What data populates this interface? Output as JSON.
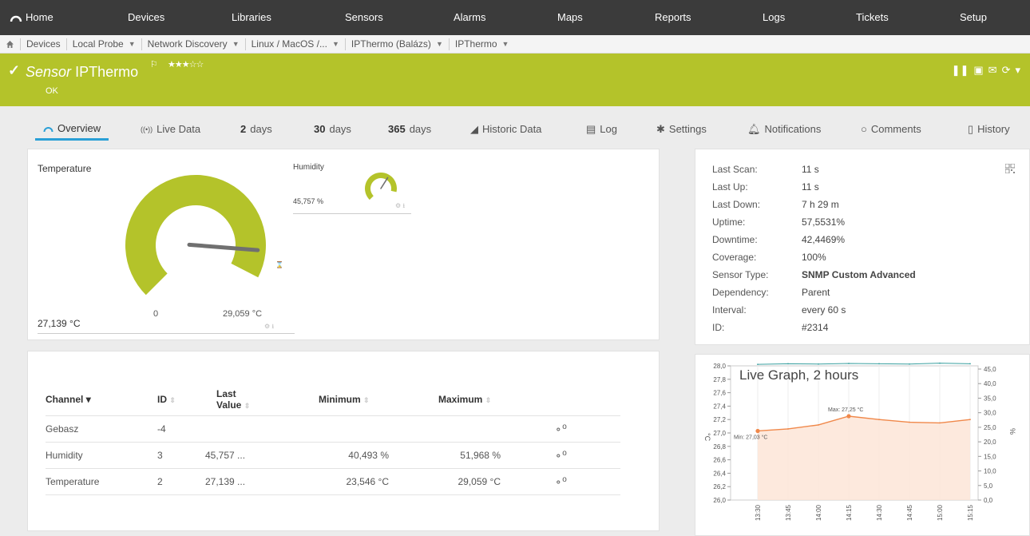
{
  "nav": {
    "home": "Home",
    "items": [
      "Devices",
      "Libraries",
      "Sensors",
      "Alarms",
      "Maps",
      "Reports",
      "Logs",
      "Tickets",
      "Setup"
    ]
  },
  "breadcrumb": [
    "Devices",
    "Local Probe",
    "Network Discovery",
    "Linux / MacOS /...",
    "IPThermo (Balázs)",
    "IPThermo"
  ],
  "header": {
    "prefix": "Sensor",
    "name": "IPThermo",
    "status": "OK",
    "stars": "★★★☆☆",
    "accent": "#b4c32a"
  },
  "tabs": {
    "overview": "Overview",
    "live": "Live Data",
    "d2_num": "2",
    "d2_unit": "days",
    "d30_num": "30",
    "d30_unit": "days",
    "d365_num": "365",
    "d365_unit": "days",
    "historic": "Historic Data",
    "log": "Log",
    "settings": "Settings",
    "notifications": "Notifications",
    "comments": "Comments",
    "history": "History"
  },
  "gauges": {
    "temperature": {
      "title": "Temperature",
      "value": "27,139 °C",
      "min": "0",
      "max": "29,059 °C",
      "level": 0.934
    },
    "humidity": {
      "title": "Humidity",
      "value": "45,757 %",
      "level": 0.88
    }
  },
  "table": {
    "headers": {
      "channel": "Channel",
      "id": "ID",
      "last_value_1": "Last",
      "last_value_2": "Value",
      "minimum": "Minimum",
      "maximum": "Maximum"
    },
    "rows": [
      {
        "channel": "Gebasz",
        "id": "-4",
        "last": "",
        "min": "",
        "max": ""
      },
      {
        "channel": "Humidity",
        "id": "3",
        "last": "45,757 ...",
        "min": "40,493 %",
        "max": "51,968 %"
      },
      {
        "channel": "Temperature",
        "id": "2",
        "last": "27,139 ...",
        "min": "23,546 °C",
        "max": "29,059 °C"
      }
    ]
  },
  "info": [
    {
      "k": "Last Scan:",
      "v": "11 s"
    },
    {
      "k": "Last Up:",
      "v": "11 s"
    },
    {
      "k": "Last Down:",
      "v": "7 h 29 m"
    },
    {
      "k": "Uptime:",
      "v": "57,5531%"
    },
    {
      "k": "Downtime:",
      "v": "42,4469%"
    },
    {
      "k": "Coverage:",
      "v": "100%"
    },
    {
      "k": "Sensor Type:",
      "v": "SNMP Custom Advanced"
    },
    {
      "k": "Dependency:",
      "v": "Parent"
    },
    {
      "k": "Interval:",
      "v": "every  60 s"
    },
    {
      "k": "ID:",
      "v": "#2314"
    }
  ],
  "graph": {
    "title": "Live Graph, 2 hours",
    "max_label": "Max: 27,25 °C",
    "min_label": "Min: 27,03 °C",
    "left_unit": "°C",
    "right_unit": "%",
    "left_ticks": [
      "28,0",
      "27,8",
      "27,6",
      "27,4",
      "27,2",
      "27,0",
      "26,8",
      "26,6",
      "26,4",
      "26,2",
      "26,0"
    ],
    "right_ticks": [
      "45,0",
      "40,0",
      "35,0",
      "30,0",
      "25,0",
      "20,0",
      "15,0",
      "10,0",
      "5,0",
      "0,0"
    ],
    "x_ticks": [
      "13:30",
      "13:45",
      "14:00",
      "14:15",
      "14:30",
      "14:45",
      "15:00",
      "15:15"
    ],
    "temp_color": "#f0884a",
    "hum_color": "#3aa0a0"
  },
  "chart_data": {
    "type": "line",
    "title": "Live Graph, 2 hours",
    "xlabel": "",
    "ylabel": "°C",
    "x": [
      "13:30",
      "13:45",
      "14:00",
      "14:15",
      "14:30",
      "14:45",
      "15:00",
      "15:15"
    ],
    "ylim": [
      26.0,
      28.0
    ],
    "y2lim": [
      0.0,
      45.0
    ],
    "series": [
      {
        "values": [
          27.03,
          27.06,
          27.12,
          27.25,
          27.2,
          27.16,
          27.15,
          27.2
        ]
      },
      {
        "axis": "right",
        "values": [
          45.5,
          45.7,
          45.6,
          45.8,
          45.7,
          45.6,
          45.9,
          45.7
        ]
      }
    ]
  }
}
